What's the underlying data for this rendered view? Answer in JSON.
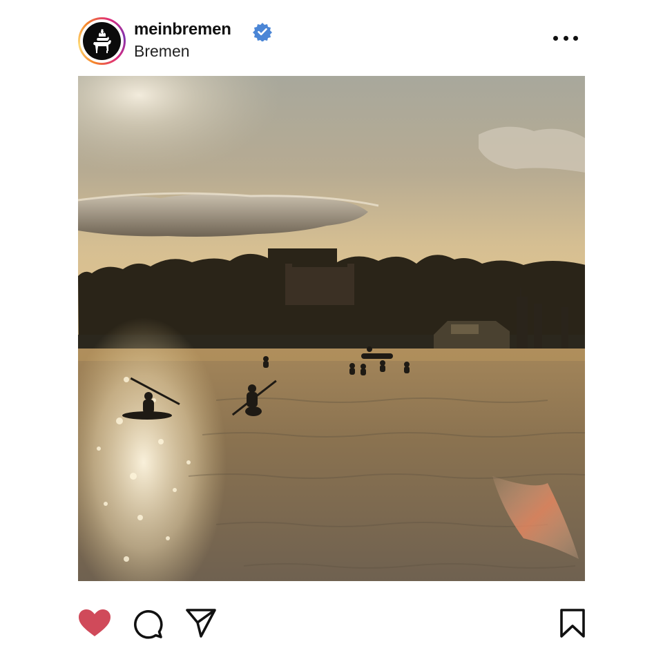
{
  "post": {
    "username": "meinbremen",
    "location": "Bremen",
    "verified": true
  },
  "icons": {
    "avatar": "town-musicians-logo-icon",
    "verified": "verified-badge-icon",
    "more": "more-options-icon",
    "like": "heart-filled-icon",
    "comment": "comment-icon",
    "share": "paper-plane-icon",
    "save": "bookmark-icon"
  },
  "colors": {
    "like": "#d04a5a",
    "verified": "#4b86d6",
    "text": "#111111"
  },
  "actions": {
    "liked": true
  }
}
